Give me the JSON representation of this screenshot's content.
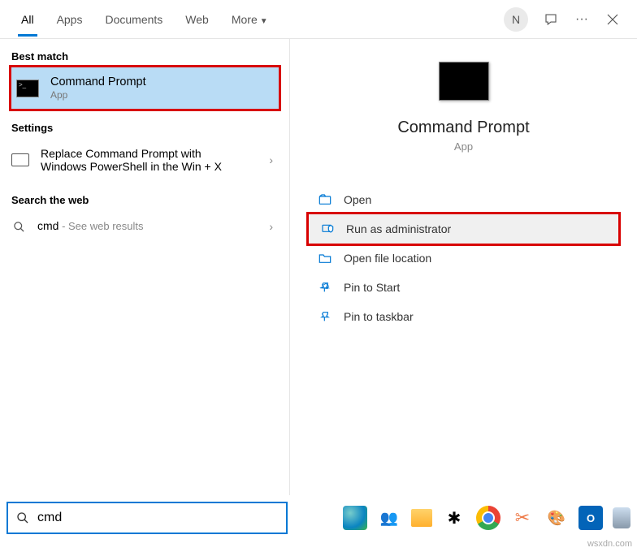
{
  "tabs": {
    "all": "All",
    "apps": "Apps",
    "documents": "Documents",
    "web": "Web",
    "more": "More"
  },
  "avatar": "N",
  "sections": {
    "best": "Best match",
    "settings": "Settings",
    "web": "Search the web"
  },
  "bestMatch": {
    "title": "Command Prompt",
    "sub": "App"
  },
  "settingsItem": {
    "line1": "Replace Command Prompt with",
    "line2": "Windows PowerShell in the Win + X"
  },
  "webItem": {
    "term": "cmd",
    "suffix": " - See web results"
  },
  "preview": {
    "title": "Command Prompt",
    "sub": "App"
  },
  "actions": {
    "open": "Open",
    "runadmin": "Run as administrator",
    "fileloc": "Open file location",
    "pinstart": "Pin to Start",
    "pintask": "Pin to taskbar"
  },
  "search": {
    "value": "cmd"
  },
  "watermark": "wsxdn.com"
}
